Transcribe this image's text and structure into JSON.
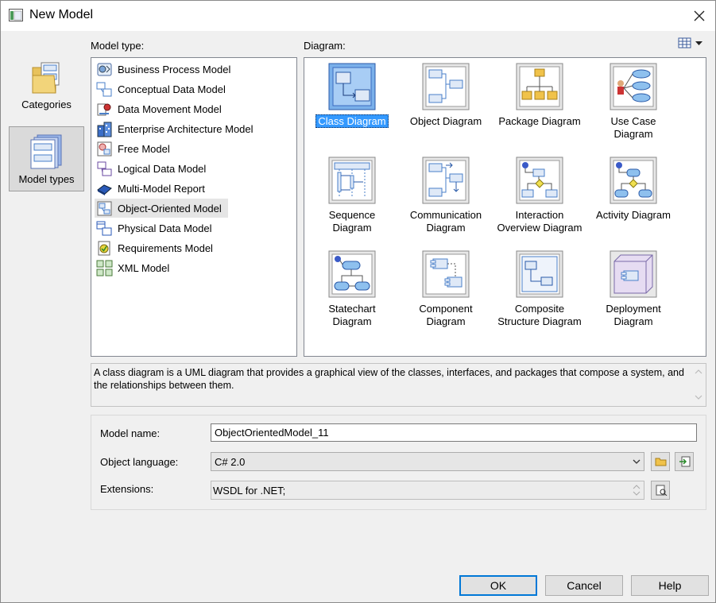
{
  "window": {
    "title": "New Model"
  },
  "nav": {
    "items": [
      {
        "label": "Categories",
        "icon": "folder-icon",
        "selected": false
      },
      {
        "label": "Model types",
        "icon": "model-types-icon",
        "selected": true
      }
    ]
  },
  "model_type": {
    "label": "Model type:",
    "items": [
      {
        "label": "Business Process Model",
        "icon": "business-process-icon"
      },
      {
        "label": "Conceptual Data Model",
        "icon": "conceptual-data-icon"
      },
      {
        "label": "Data Movement Model",
        "icon": "data-movement-icon"
      },
      {
        "label": "Enterprise Architecture Model",
        "icon": "enterprise-architecture-icon"
      },
      {
        "label": "Free Model",
        "icon": "free-model-icon"
      },
      {
        "label": "Logical Data Model",
        "icon": "logical-data-icon"
      },
      {
        "label": "Multi-Model Report",
        "icon": "report-book-icon"
      },
      {
        "label": "Object-Oriented Model",
        "icon": "object-oriented-icon",
        "selected": true
      },
      {
        "label": "Physical Data Model",
        "icon": "physical-data-icon"
      },
      {
        "label": "Requirements Model",
        "icon": "requirements-icon"
      },
      {
        "label": "XML Model",
        "icon": "xml-model-icon"
      }
    ]
  },
  "diagram": {
    "label": "Diagram:",
    "items": [
      {
        "line1": "Class Diagram",
        "line2": "",
        "icon": "class-diagram-icon",
        "selected": true
      },
      {
        "line1": "Object Diagram",
        "line2": "",
        "icon": "object-diagram-icon"
      },
      {
        "line1": "Package Diagram",
        "line2": "",
        "icon": "package-diagram-icon"
      },
      {
        "line1": "Use Case",
        "line2": "Diagram",
        "icon": "use-case-diagram-icon"
      },
      {
        "line1": "Sequence",
        "line2": "Diagram",
        "icon": "sequence-diagram-icon"
      },
      {
        "line1": "Communication",
        "line2": "Diagram",
        "icon": "communication-diagram-icon"
      },
      {
        "line1": "Interaction",
        "line2": "Overview Diagram",
        "icon": "interaction-overview-icon"
      },
      {
        "line1": "Activity Diagram",
        "line2": "",
        "icon": "activity-diagram-icon"
      },
      {
        "line1": "Statechart",
        "line2": "Diagram",
        "icon": "statechart-diagram-icon"
      },
      {
        "line1": "Component",
        "line2": "Diagram",
        "icon": "component-diagram-icon"
      },
      {
        "line1": "Composite",
        "line2": "Structure Diagram",
        "icon": "composite-structure-icon"
      },
      {
        "line1": "Deployment",
        "line2": "Diagram",
        "icon": "deployment-diagram-icon"
      }
    ]
  },
  "description": "A class diagram is a UML diagram that provides a graphical view of the classes, interfaces, and packages that compose a system, and the relationships between them.",
  "properties": {
    "model_name_label": "Model name:",
    "model_name_value": "ObjectOrientedModel_11",
    "object_language_label": "Object language:",
    "object_language_value": "C# 2.0",
    "extensions_label": "Extensions:",
    "extensions_value": "WSDL for .NET;"
  },
  "buttons": {
    "ok": "OK",
    "cancel": "Cancel",
    "help": "Help"
  },
  "colors": {
    "selection": "#3399ff",
    "default_button_border": "#0078d7",
    "icon_blue": "#4a7fc9"
  }
}
